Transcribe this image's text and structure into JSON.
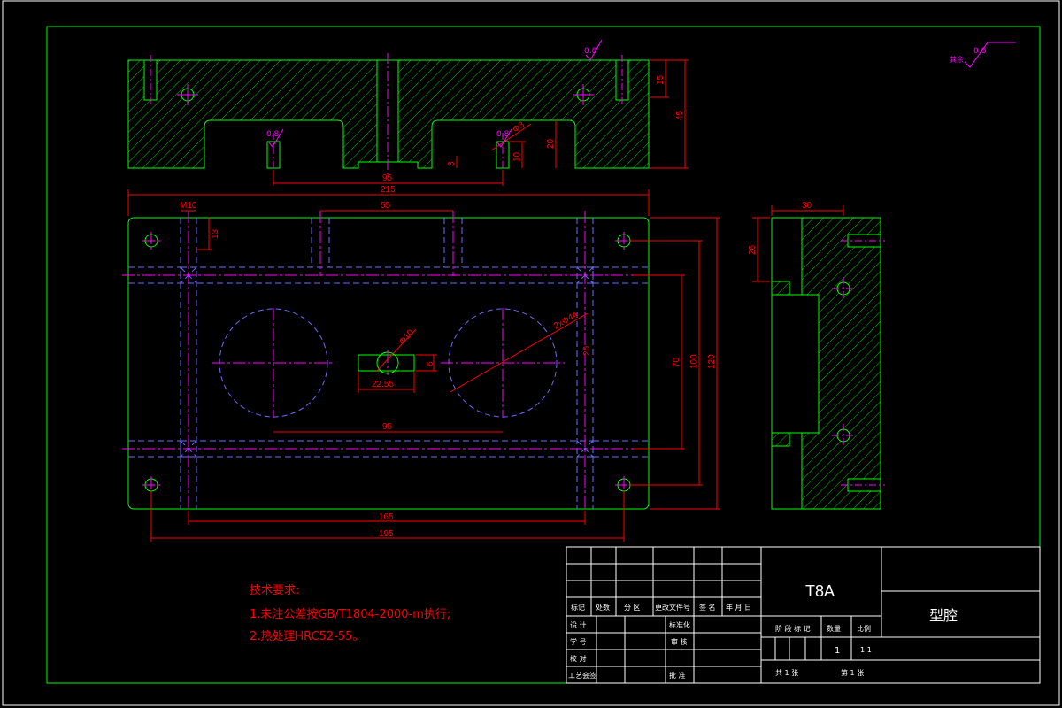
{
  "drawing": {
    "material": "T8A",
    "part_name": "型腔",
    "scale": "1:1",
    "quantity": "1",
    "sheet_total": "共 1 张",
    "sheet_number": "第 1 张"
  },
  "tech_notes": {
    "heading": "技术要求:",
    "line1": "1.未注公差按GB/T1804-2000-m执行;",
    "line2": "2.热处理HRC52-55。"
  },
  "roughness": {
    "general_prefix": "其余",
    "general_value": "0.8",
    "top_surface": "0.8",
    "hole_left": "0.8",
    "hole_right": "0.8"
  },
  "dimensions": {
    "front_width_bottom": "95",
    "front_height_total": "45",
    "front_height_upper": "15",
    "front_pocket_depth": "20",
    "front_hole_depth": "10",
    "front_step": "3",
    "front_hole_dia": "Φ3",
    "plan_overall_width": "215",
    "plan_thread": "M10",
    "plan_thread_depth": "13",
    "plan_slot_spacing": "55",
    "plan_bore_dia": "2xΦ44",
    "plan_center_hole_dia": "Φ10",
    "plan_slot_height": "6",
    "plan_slot_length": "22.55",
    "plan_bore_spacing": "95",
    "plan_dim_20": "20",
    "plan_hole_span_70": "70",
    "plan_hole_span_100": "100",
    "plan_height_120": "120",
    "plan_hole_spacing_165": "165",
    "plan_hole_spacing_195": "195",
    "side_width": "30",
    "side_height": "26"
  },
  "title_block": {
    "col_mark": "标记",
    "col_count": "处数",
    "col_zone": "分 区",
    "col_doc": "更改文件号",
    "col_sign": "签 名",
    "col_date": "年 月 日",
    "row_design": "设 计",
    "row_std": "标准化",
    "row_draw": "审 核",
    "row_check": "校 对",
    "row_process": "工艺会签",
    "row_approve": "批 准",
    "row_audit": "学 号",
    "stage_label": "阶 段 标 记",
    "qty_label": "数量",
    "scale_label": "比例"
  },
  "colors": {
    "background": "#000000",
    "outline": "#00ff00",
    "hatch": "#00cc00",
    "centerline": "#ff00ff",
    "hidden": "#6a6aff",
    "dimension": "#ff0000",
    "text": "#ffffff"
  }
}
